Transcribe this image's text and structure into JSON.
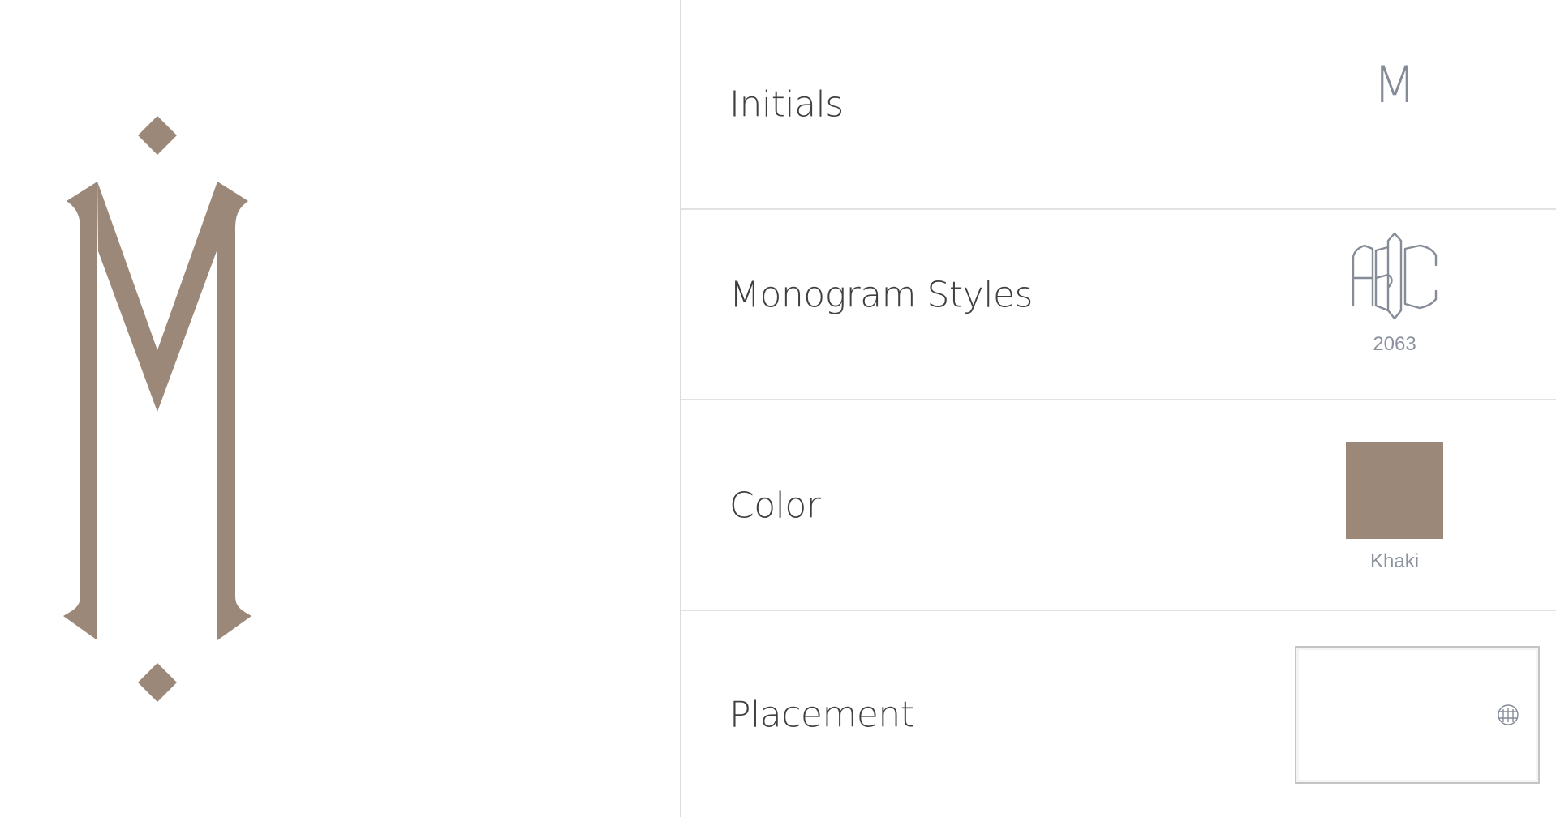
{
  "preview": {
    "monogram_letter": "M",
    "color": "#9c8878"
  },
  "options": {
    "rows": [
      {
        "label": "Initials",
        "value": "M"
      },
      {
        "label": "Monogram Styles",
        "style_sample": "ABC",
        "caption": "2063"
      },
      {
        "label": "Color",
        "caption": "Khaki",
        "swatch_color": "#9c8878"
      },
      {
        "label": "Placement",
        "mark_icon": "monogram-mark-icon"
      }
    ]
  },
  "colors": {
    "monogram": "#9c8878",
    "label_text": "#3f3f42",
    "value_text": "#858c98",
    "divider": "#dcdcdc"
  }
}
